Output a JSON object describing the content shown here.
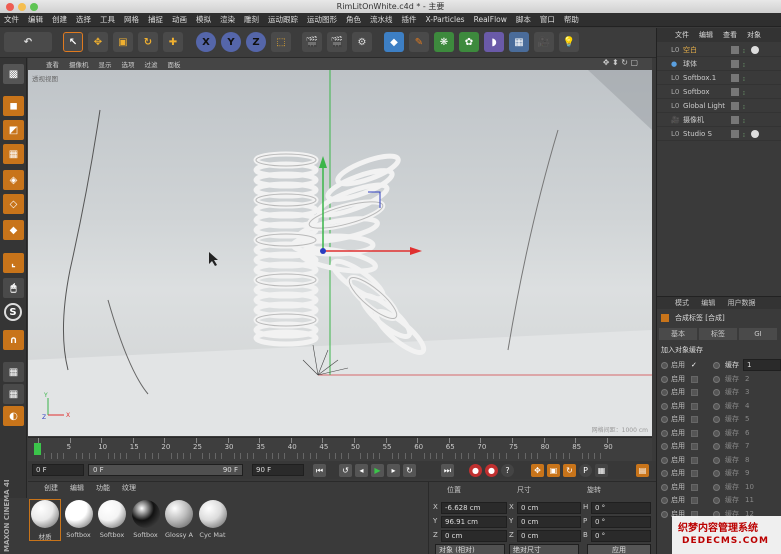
{
  "window": {
    "title": "RimLitOnWhite.c4d * - 主要"
  },
  "menu": [
    "文件",
    "编辑",
    "创建",
    "选择",
    "工具",
    "网格",
    "捕捉",
    "动画",
    "模拟",
    "渲染",
    "雕刻",
    "运动跟踪",
    "运动图形",
    "角色",
    "流水线",
    "插件",
    "X-Particles",
    "RealFlow",
    "脚本",
    "窗口",
    "帮助"
  ],
  "toolbar": {
    "axis_x": "X",
    "axis_y": "Y",
    "axis_z": "Z"
  },
  "viewport": {
    "menu": [
      "查看",
      "摄像机",
      "显示",
      "选项",
      "过滤",
      "面板"
    ],
    "label": "透视视图",
    "grid_info": "网格间距：1000 cm"
  },
  "timeline": {
    "ticks": [
      "0",
      "5",
      "10",
      "15",
      "20",
      "25",
      "30",
      "35",
      "40",
      "45",
      "50",
      "55",
      "60",
      "65",
      "70",
      "75",
      "80",
      "85",
      "90"
    ],
    "start_frame": "0 F",
    "current_field": "0 F",
    "end_field": "90 F",
    "end_frame": "90 F"
  },
  "material_manager": {
    "menu": [
      "创建",
      "编辑",
      "功能",
      "纹理"
    ],
    "materials": [
      {
        "name": "材质",
        "color": "#e9e9e9"
      },
      {
        "name": "Softbox",
        "color": "#ffffff"
      },
      {
        "name": "Softbox",
        "color": "#f4f4f4"
      },
      {
        "name": "Softbox",
        "color": "#111111"
      },
      {
        "name": "Glossy A",
        "color": "#bdbdbd"
      },
      {
        "name": "Cyc Mat",
        "color": "#dcdcdc"
      }
    ]
  },
  "coordinates": {
    "headers": {
      "position": "位置",
      "size": "尺寸",
      "rotation": "旋转"
    },
    "rows": [
      {
        "axis": "X",
        "pos": "-6.628 cm",
        "size_axis": "X",
        "size": "0 cm",
        "rot_axis": "H",
        "rot": "0 °"
      },
      {
        "axis": "Y",
        "pos": "96.91 cm",
        "size_axis": "Y",
        "size": "0 cm",
        "rot_axis": "P",
        "rot": "0 °"
      },
      {
        "axis": "Z",
        "pos": "0 cm",
        "size_axis": "Z",
        "size": "0 cm",
        "rot_axis": "B",
        "rot": "0 °"
      }
    ],
    "mode_select": "对象 (相对)",
    "size_select": "绝对尺寸",
    "apply_label": "应用"
  },
  "object_manager": {
    "tabs": [
      "文件",
      "编辑",
      "查看",
      "对象"
    ],
    "objects": [
      {
        "name": "空白",
        "color": "#e8b04a"
      },
      {
        "name": "球体",
        "color": "#ccc"
      },
      {
        "name": "Softbox.1",
        "color": "#ccc"
      },
      {
        "name": "Softbox",
        "color": "#ccc"
      },
      {
        "name": "Global Light",
        "color": "#ccc"
      },
      {
        "name": "摄像机",
        "color": "#ccc"
      },
      {
        "name": "Studio S",
        "color": "#ccc"
      }
    ]
  },
  "attribute_manager": {
    "menu": [
      "模式",
      "编辑",
      "用户数据"
    ],
    "title": "合成标签 [合成]",
    "tabs": [
      "基本",
      "标签",
      "GI"
    ],
    "section": "加入对象缓存",
    "enable_label": "启用",
    "cache_label": "缓存",
    "first_cache_value": "1",
    "cache_numbers": [
      "2",
      "3",
      "4",
      "5",
      "6",
      "7",
      "8",
      "9",
      "10",
      "11",
      "12"
    ]
  },
  "brand": {
    "vertical": "MAXON CINEMA 4D"
  },
  "watermark": {
    "line1": "织梦内容管理系统",
    "line2": "DEDECMS.COM"
  }
}
